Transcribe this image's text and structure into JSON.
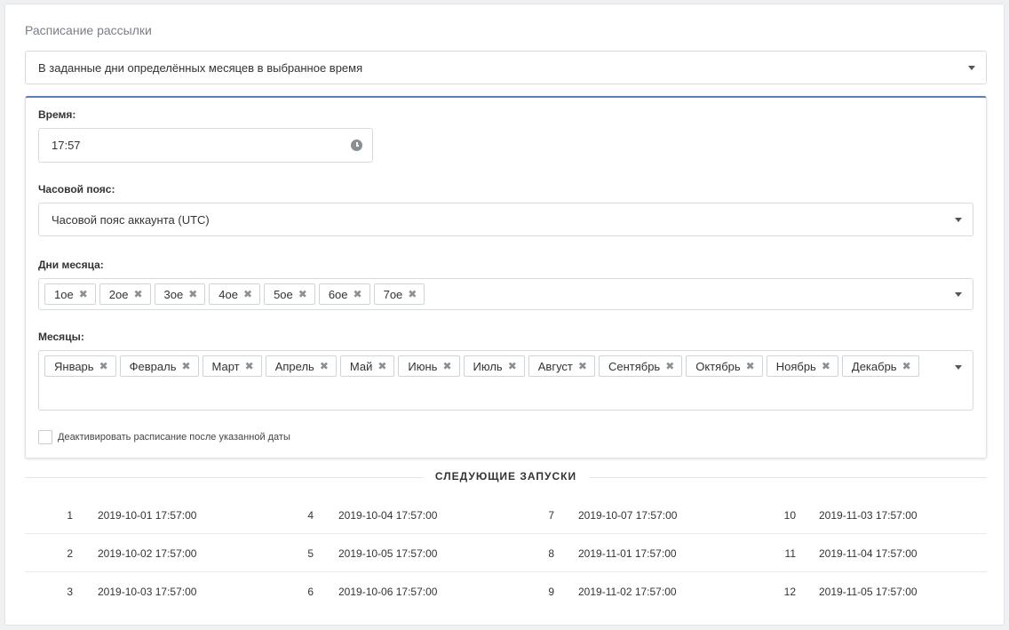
{
  "schedule": {
    "title": "Расписание рассылки",
    "mode_value": "В заданные дни определённых месяцев в выбранное время"
  },
  "time": {
    "label": "Время:",
    "value": "17:57"
  },
  "timezone": {
    "label": "Часовой пояс:",
    "value": "Часовой пояс аккаунта (UTC)"
  },
  "days": {
    "label": "Дни месяца:",
    "tags": [
      "1ое",
      "2ое",
      "3ое",
      "4ое",
      "5ое",
      "6ое",
      "7ое"
    ]
  },
  "months": {
    "label": "Месяцы:",
    "tags": [
      "Январь",
      "Февраль",
      "Март",
      "Апрель",
      "Май",
      "Июнь",
      "Июль",
      "Август",
      "Сентябрь",
      "Октябрь",
      "Ноябрь",
      "Декабрь"
    ]
  },
  "deactivate": {
    "label": "Деактивировать расписание после указанной даты",
    "checked": false
  },
  "next_runs": {
    "heading": "СЛЕДУЮЩИЕ ЗАПУСКИ",
    "rows": [
      [
        {
          "n": "1",
          "date": "2019-10-01 17:57:00"
        },
        {
          "n": "4",
          "date": "2019-10-04 17:57:00"
        },
        {
          "n": "7",
          "date": "2019-10-07 17:57:00"
        },
        {
          "n": "10",
          "date": "2019-11-03 17:57:00"
        }
      ],
      [
        {
          "n": "2",
          "date": "2019-10-02 17:57:00"
        },
        {
          "n": "5",
          "date": "2019-10-05 17:57:00"
        },
        {
          "n": "8",
          "date": "2019-11-01 17:57:00"
        },
        {
          "n": "11",
          "date": "2019-11-04 17:57:00"
        }
      ],
      [
        {
          "n": "3",
          "date": "2019-10-03 17:57:00"
        },
        {
          "n": "6",
          "date": "2019-10-06 17:57:00"
        },
        {
          "n": "9",
          "date": "2019-11-02 17:57:00"
        },
        {
          "n": "12",
          "date": "2019-11-05 17:57:00"
        }
      ]
    ]
  },
  "icons": {
    "remove": "✖",
    "clock": "clock-icon",
    "dropdown": "chevron-down-icon"
  }
}
